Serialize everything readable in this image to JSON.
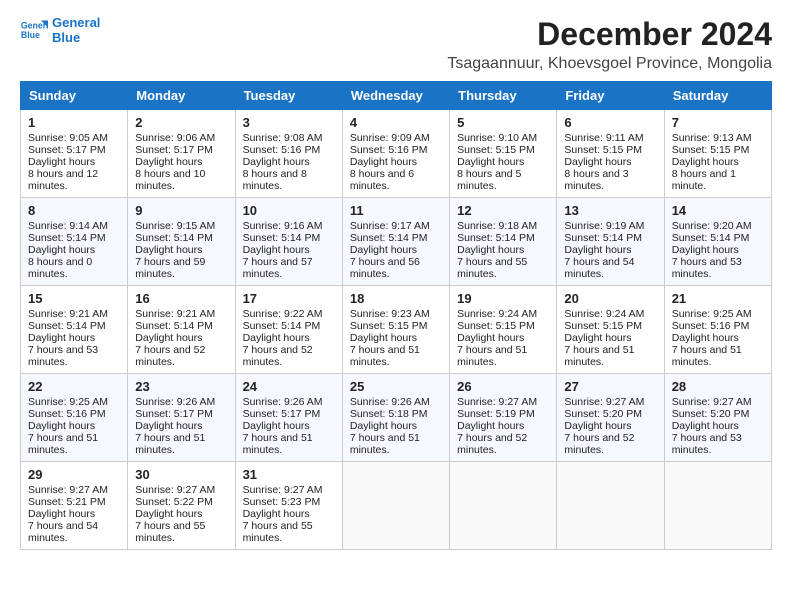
{
  "logo": {
    "line1": "General",
    "line2": "Blue"
  },
  "title": "December 2024",
  "subtitle": "Tsagaannuur, Khoevsgoel Province, Mongolia",
  "days": [
    "Sunday",
    "Monday",
    "Tuesday",
    "Wednesday",
    "Thursday",
    "Friday",
    "Saturday"
  ],
  "weeks": [
    [
      {
        "day": "1",
        "sunrise": "9:05 AM",
        "sunset": "5:17 PM",
        "daylight": "8 hours and 12 minutes."
      },
      {
        "day": "2",
        "sunrise": "9:06 AM",
        "sunset": "5:17 PM",
        "daylight": "8 hours and 10 minutes."
      },
      {
        "day": "3",
        "sunrise": "9:08 AM",
        "sunset": "5:16 PM",
        "daylight": "8 hours and 8 minutes."
      },
      {
        "day": "4",
        "sunrise": "9:09 AM",
        "sunset": "5:16 PM",
        "daylight": "8 hours and 6 minutes."
      },
      {
        "day": "5",
        "sunrise": "9:10 AM",
        "sunset": "5:15 PM",
        "daylight": "8 hours and 5 minutes."
      },
      {
        "day": "6",
        "sunrise": "9:11 AM",
        "sunset": "5:15 PM",
        "daylight": "8 hours and 3 minutes."
      },
      {
        "day": "7",
        "sunrise": "9:13 AM",
        "sunset": "5:15 PM",
        "daylight": "8 hours and 1 minute."
      }
    ],
    [
      {
        "day": "8",
        "sunrise": "9:14 AM",
        "sunset": "5:14 PM",
        "daylight": "8 hours and 0 minutes."
      },
      {
        "day": "9",
        "sunrise": "9:15 AM",
        "sunset": "5:14 PM",
        "daylight": "7 hours and 59 minutes."
      },
      {
        "day": "10",
        "sunrise": "9:16 AM",
        "sunset": "5:14 PM",
        "daylight": "7 hours and 57 minutes."
      },
      {
        "day": "11",
        "sunrise": "9:17 AM",
        "sunset": "5:14 PM",
        "daylight": "7 hours and 56 minutes."
      },
      {
        "day": "12",
        "sunrise": "9:18 AM",
        "sunset": "5:14 PM",
        "daylight": "7 hours and 55 minutes."
      },
      {
        "day": "13",
        "sunrise": "9:19 AM",
        "sunset": "5:14 PM",
        "daylight": "7 hours and 54 minutes."
      },
      {
        "day": "14",
        "sunrise": "9:20 AM",
        "sunset": "5:14 PM",
        "daylight": "7 hours and 53 minutes."
      }
    ],
    [
      {
        "day": "15",
        "sunrise": "9:21 AM",
        "sunset": "5:14 PM",
        "daylight": "7 hours and 53 minutes."
      },
      {
        "day": "16",
        "sunrise": "9:21 AM",
        "sunset": "5:14 PM",
        "daylight": "7 hours and 52 minutes."
      },
      {
        "day": "17",
        "sunrise": "9:22 AM",
        "sunset": "5:14 PM",
        "daylight": "7 hours and 52 minutes."
      },
      {
        "day": "18",
        "sunrise": "9:23 AM",
        "sunset": "5:15 PM",
        "daylight": "7 hours and 51 minutes."
      },
      {
        "day": "19",
        "sunrise": "9:24 AM",
        "sunset": "5:15 PM",
        "daylight": "7 hours and 51 minutes."
      },
      {
        "day": "20",
        "sunrise": "9:24 AM",
        "sunset": "5:15 PM",
        "daylight": "7 hours and 51 minutes."
      },
      {
        "day": "21",
        "sunrise": "9:25 AM",
        "sunset": "5:16 PM",
        "daylight": "7 hours and 51 minutes."
      }
    ],
    [
      {
        "day": "22",
        "sunrise": "9:25 AM",
        "sunset": "5:16 PM",
        "daylight": "7 hours and 51 minutes."
      },
      {
        "day": "23",
        "sunrise": "9:26 AM",
        "sunset": "5:17 PM",
        "daylight": "7 hours and 51 minutes."
      },
      {
        "day": "24",
        "sunrise": "9:26 AM",
        "sunset": "5:17 PM",
        "daylight": "7 hours and 51 minutes."
      },
      {
        "day": "25",
        "sunrise": "9:26 AM",
        "sunset": "5:18 PM",
        "daylight": "7 hours and 51 minutes."
      },
      {
        "day": "26",
        "sunrise": "9:27 AM",
        "sunset": "5:19 PM",
        "daylight": "7 hours and 52 minutes."
      },
      {
        "day": "27",
        "sunrise": "9:27 AM",
        "sunset": "5:20 PM",
        "daylight": "7 hours and 52 minutes."
      },
      {
        "day": "28",
        "sunrise": "9:27 AM",
        "sunset": "5:20 PM",
        "daylight": "7 hours and 53 minutes."
      }
    ],
    [
      {
        "day": "29",
        "sunrise": "9:27 AM",
        "sunset": "5:21 PM",
        "daylight": "7 hours and 54 minutes."
      },
      {
        "day": "30",
        "sunrise": "9:27 AM",
        "sunset": "5:22 PM",
        "daylight": "7 hours and 55 minutes."
      },
      {
        "day": "31",
        "sunrise": "9:27 AM",
        "sunset": "5:23 PM",
        "daylight": "7 hours and 55 minutes."
      },
      null,
      null,
      null,
      null
    ]
  ],
  "labels": {
    "sunrise": "Sunrise:",
    "sunset": "Sunset:",
    "daylight": "Daylight hours"
  }
}
